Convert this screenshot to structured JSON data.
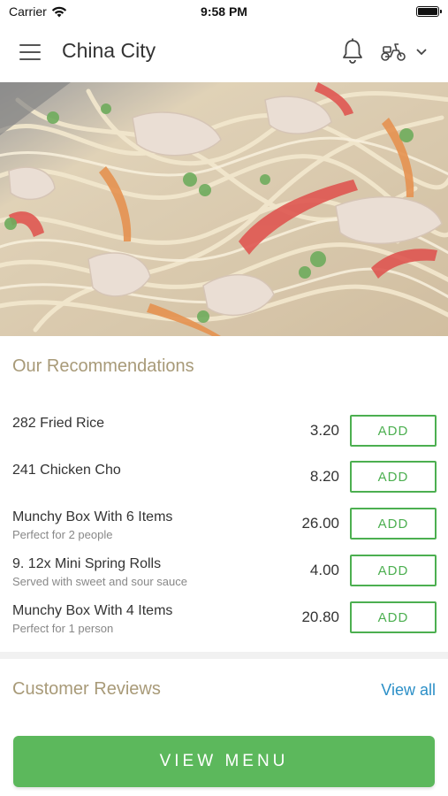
{
  "status_bar": {
    "carrier": "Carrier",
    "time": "9:58 PM",
    "battery_level": 1.0
  },
  "header": {
    "title": "China City",
    "menu_icon": "hamburger-icon",
    "notification_icon": "bell-icon",
    "delivery_icon": "scooter-icon",
    "dropdown_icon": "chevron-down-icon"
  },
  "recommendations": {
    "title": "Our Recommendations",
    "add_label": "ADD",
    "items": [
      {
        "name": "282 Fried Rice",
        "subtitle": "",
        "price": "3.20"
      },
      {
        "name": "241 Chicken Cho",
        "subtitle": "",
        "price": "8.20"
      },
      {
        "name": "Munchy Box With 6 Items",
        "subtitle": "Perfect for 2 people",
        "price": "26.00"
      },
      {
        "name": "9. 12x Mini Spring Rolls",
        "subtitle": "Served with sweet and sour sauce",
        "price": "4.00"
      },
      {
        "name": "Munchy Box With 4 Items",
        "subtitle": "Perfect for 1 person",
        "price": "20.80"
      }
    ]
  },
  "reviews": {
    "title": "Customer Reviews",
    "view_all": "View all"
  },
  "footer": {
    "view_menu": "VIEW MENU"
  },
  "colors": {
    "accent_green": "#5cb85c",
    "link_blue": "#2b8fc7",
    "section_title": "#a89a78"
  }
}
